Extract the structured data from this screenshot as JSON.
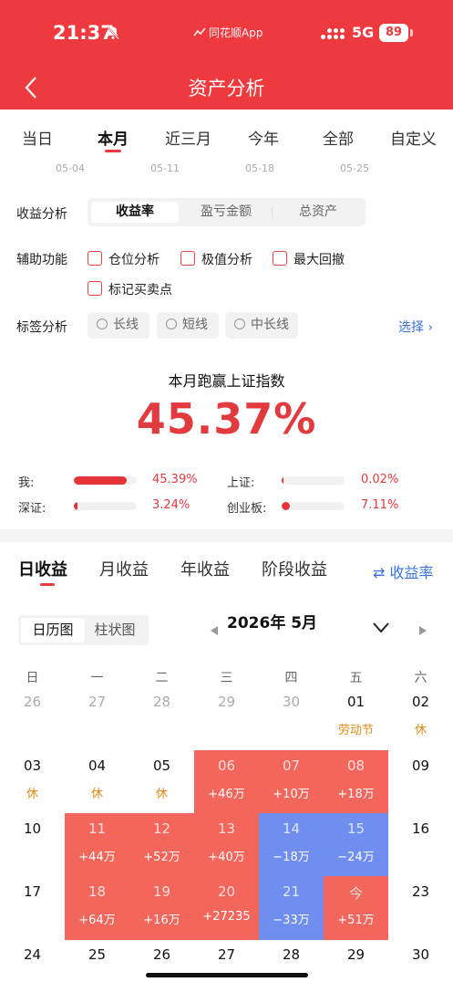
{
  "status": {
    "time": "21:37",
    "app": "同花顺App",
    "network": "5G",
    "battery": "89"
  },
  "header": {
    "title": "资产分析"
  },
  "tabs": [
    {
      "label": "当日",
      "active": false
    },
    {
      "label": "本月",
      "active": true
    },
    {
      "label": "近三月",
      "active": false
    },
    {
      "label": "今年",
      "active": false
    },
    {
      "label": "全部",
      "active": false
    },
    {
      "label": "自定义",
      "active": false
    }
  ],
  "date_ticks": [
    "05-04",
    "05-11",
    "05-18",
    "05-25"
  ],
  "earnings": {
    "label": "收益分析",
    "options": [
      "收益率",
      "盈亏金额",
      "总资产"
    ],
    "selected": "收益率"
  },
  "assist": {
    "label": "辅助功能",
    "options": [
      "仓位分析",
      "极值分析",
      "最大回撤",
      "标记买卖点"
    ]
  },
  "tags": {
    "label": "标签分析",
    "options": [
      "长线",
      "短线",
      "中长线"
    ],
    "select": "选择"
  },
  "beat": {
    "title": "本月跑赢上证指数",
    "value": "45.37%"
  },
  "comparisons": [
    {
      "label": "我:",
      "value": "45.39%",
      "pct": 45.39
    },
    {
      "label": "上证:",
      "value": "0.02%",
      "pct": 0.02
    },
    {
      "label": "深证:",
      "value": "3.24%",
      "pct": 3.24
    },
    {
      "label": "创业板:",
      "value": "7.11%",
      "pct": 7.11
    }
  ],
  "sub_tabs": [
    "日收益",
    "月收益",
    "年收益",
    "阶段收益"
  ],
  "switch": "收益率",
  "views": [
    "日历图",
    "柱状图"
  ],
  "month_title": "2026年 5月",
  "weekdays": [
    "日",
    "一",
    "二",
    "三",
    "四",
    "五",
    "六"
  ],
  "weeks": [
    [
      {
        "d": "26",
        "dim": true
      },
      {
        "d": "27",
        "dim": true
      },
      {
        "d": "28",
        "dim": true
      },
      {
        "d": "29",
        "dim": true
      },
      {
        "d": "30",
        "dim": true
      },
      {
        "d": "01",
        "note": "劳动节"
      },
      {
        "d": "02",
        "note": "休"
      }
    ],
    [
      {
        "d": "03",
        "note": "休"
      },
      {
        "d": "04",
        "note": "休"
      },
      {
        "d": "05",
        "note": "休"
      },
      {
        "d": "06",
        "note": "+46万",
        "kind": "red"
      },
      {
        "d": "07",
        "note": "+10万",
        "kind": "red"
      },
      {
        "d": "08",
        "note": "+18万",
        "kind": "red"
      },
      {
        "d": "09"
      }
    ],
    [
      {
        "d": "10"
      },
      {
        "d": "11",
        "note": "+44万",
        "kind": "red"
      },
      {
        "d": "12",
        "note": "+52万",
        "kind": "red"
      },
      {
        "d": "13",
        "note": "+40万",
        "kind": "red"
      },
      {
        "d": "14",
        "note": "−18万",
        "kind": "blue"
      },
      {
        "d": "15",
        "note": "−24万",
        "kind": "blue"
      },
      {
        "d": "16"
      }
    ],
    [
      {
        "d": "17"
      },
      {
        "d": "18",
        "note": "+64万",
        "kind": "red"
      },
      {
        "d": "19",
        "note": "+16万",
        "kind": "red"
      },
      {
        "d": "20",
        "note": "+27235",
        "kind": "red"
      },
      {
        "d": "21",
        "note": "−33万",
        "kind": "blue"
      },
      {
        "d": "今",
        "note": "+51万",
        "kind": "red"
      },
      {
        "d": "23"
      }
    ],
    [
      {
        "d": "24"
      },
      {
        "d": "25"
      },
      {
        "d": "26"
      },
      {
        "d": "27"
      },
      {
        "d": "28"
      },
      {
        "d": "29"
      },
      {
        "d": "30"
      }
    ]
  ]
}
